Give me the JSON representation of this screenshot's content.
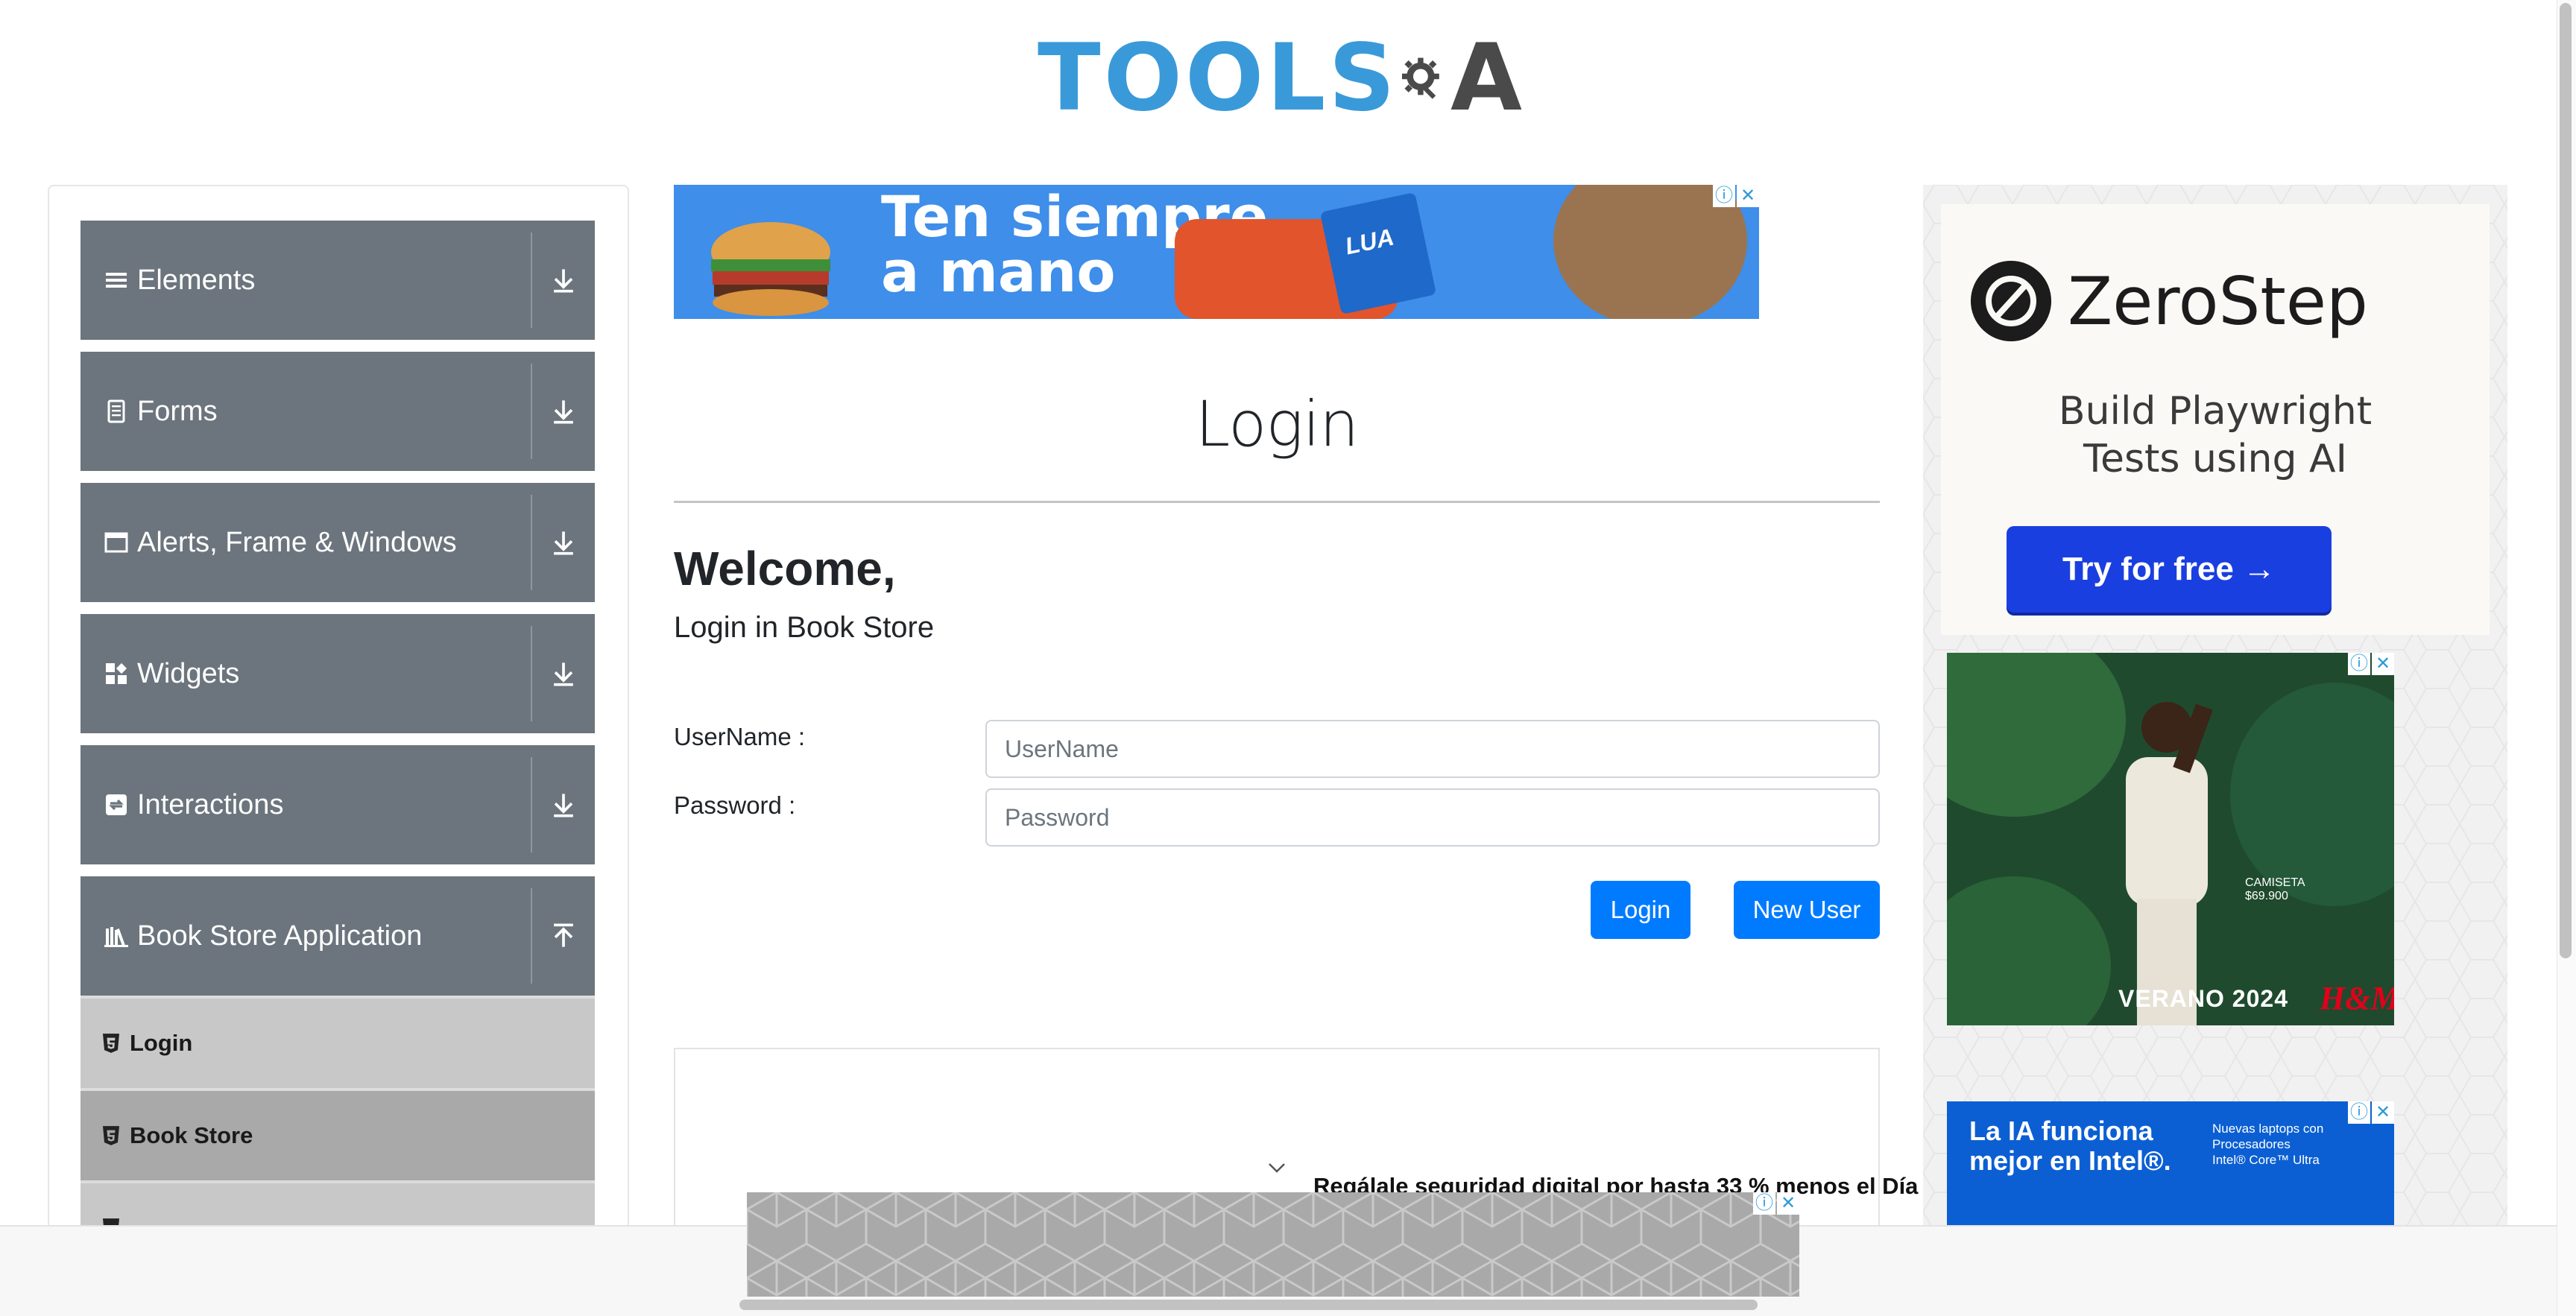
{
  "header": {
    "logo_left": "TOOLS",
    "logo_right": "A"
  },
  "sidebar": {
    "groups": [
      {
        "label": "Elements",
        "icon": "hamburger-icon",
        "arrow": "expand"
      },
      {
        "label": "Forms",
        "icon": "form-icon",
        "arrow": "expand"
      },
      {
        "label": "Alerts, Frame & Windows",
        "icon": "window-icon",
        "arrow": "expand"
      },
      {
        "label": "Widgets",
        "icon": "widgets-icon",
        "arrow": "expand"
      },
      {
        "label": "Interactions",
        "icon": "interactions-icon",
        "arrow": "expand"
      },
      {
        "label": "Book Store Application",
        "icon": "books-icon",
        "arrow": "collapse"
      }
    ],
    "subitems": [
      {
        "label": "Login",
        "icon": "html5-icon",
        "active": false
      },
      {
        "label": "Book Store",
        "icon": "html5-icon",
        "active": true
      },
      {
        "label": "",
        "icon": "html5-icon",
        "active": false
      }
    ]
  },
  "ad_top": {
    "text_line1": "Ten siempre",
    "text_line2": "a mano",
    "bag_label": "LUA"
  },
  "main": {
    "title": "Login",
    "welcome": "Welcome,",
    "subtitle": "Login in Book Store",
    "username_label": "UserName :",
    "username_placeholder": "UserName",
    "password_label": "Password :",
    "password_placeholder": "Password",
    "login_button": "Login",
    "new_user_button": "New User"
  },
  "right_ads": {
    "zerostep_name": "ZeroStep",
    "zerostep_tagline_1": "Build Playwright",
    "zerostep_tagline_2": "Tests using AI",
    "zerostep_button": "Try for free →",
    "hm_footer": "VERANO 2024",
    "hm_brand": "H&M",
    "hm_product": "CAMISETA",
    "hm_price": "$69.900",
    "intel_line1": "La IA funciona",
    "intel_line2": "mejor en Intel®.",
    "intel_small1": "Nuevas laptops con",
    "intel_small2": "Procesadores",
    "intel_small3": "Intel® Core™ Ultra"
  },
  "bottom": {
    "promo": "Regálale seguridad digital por hasta 33 % menos el Día"
  },
  "colors": {
    "sidebar_group": "#6c757d",
    "primary": "#007bff",
    "zerostep_button": "#1a3fe0",
    "logo_blue": "#3a9ad9"
  }
}
